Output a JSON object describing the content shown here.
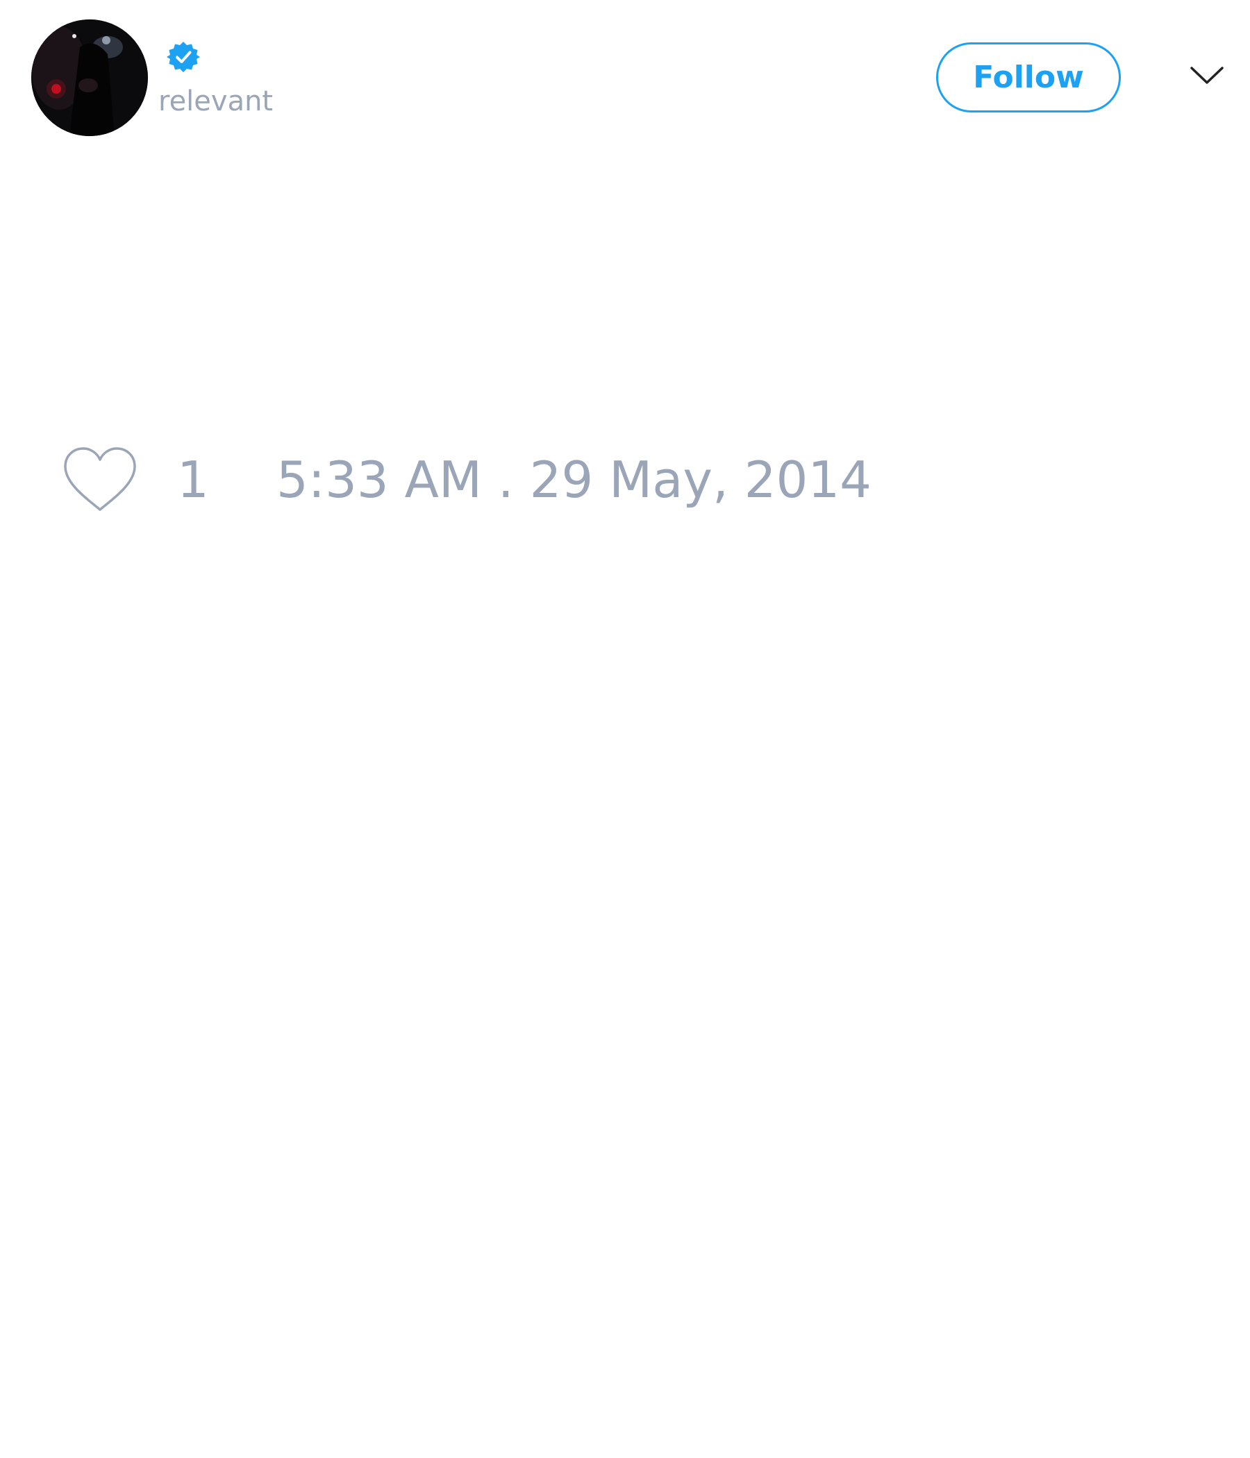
{
  "tweet": {
    "author": {
      "handle": "relevant",
      "verified": true,
      "avatar_icon": "profile-photo"
    },
    "follow_label": "Follow",
    "menu_icon": "chevron-down-icon",
    "like_icon": "heart-outline-icon",
    "like_count": "1",
    "timestamp": "5:33 AM . 29 May, 2014"
  },
  "colors": {
    "accent": "#1da1f2",
    "muted_text": "#9aa5b8",
    "background": "#ffffff",
    "menu_icon": "#222222"
  }
}
